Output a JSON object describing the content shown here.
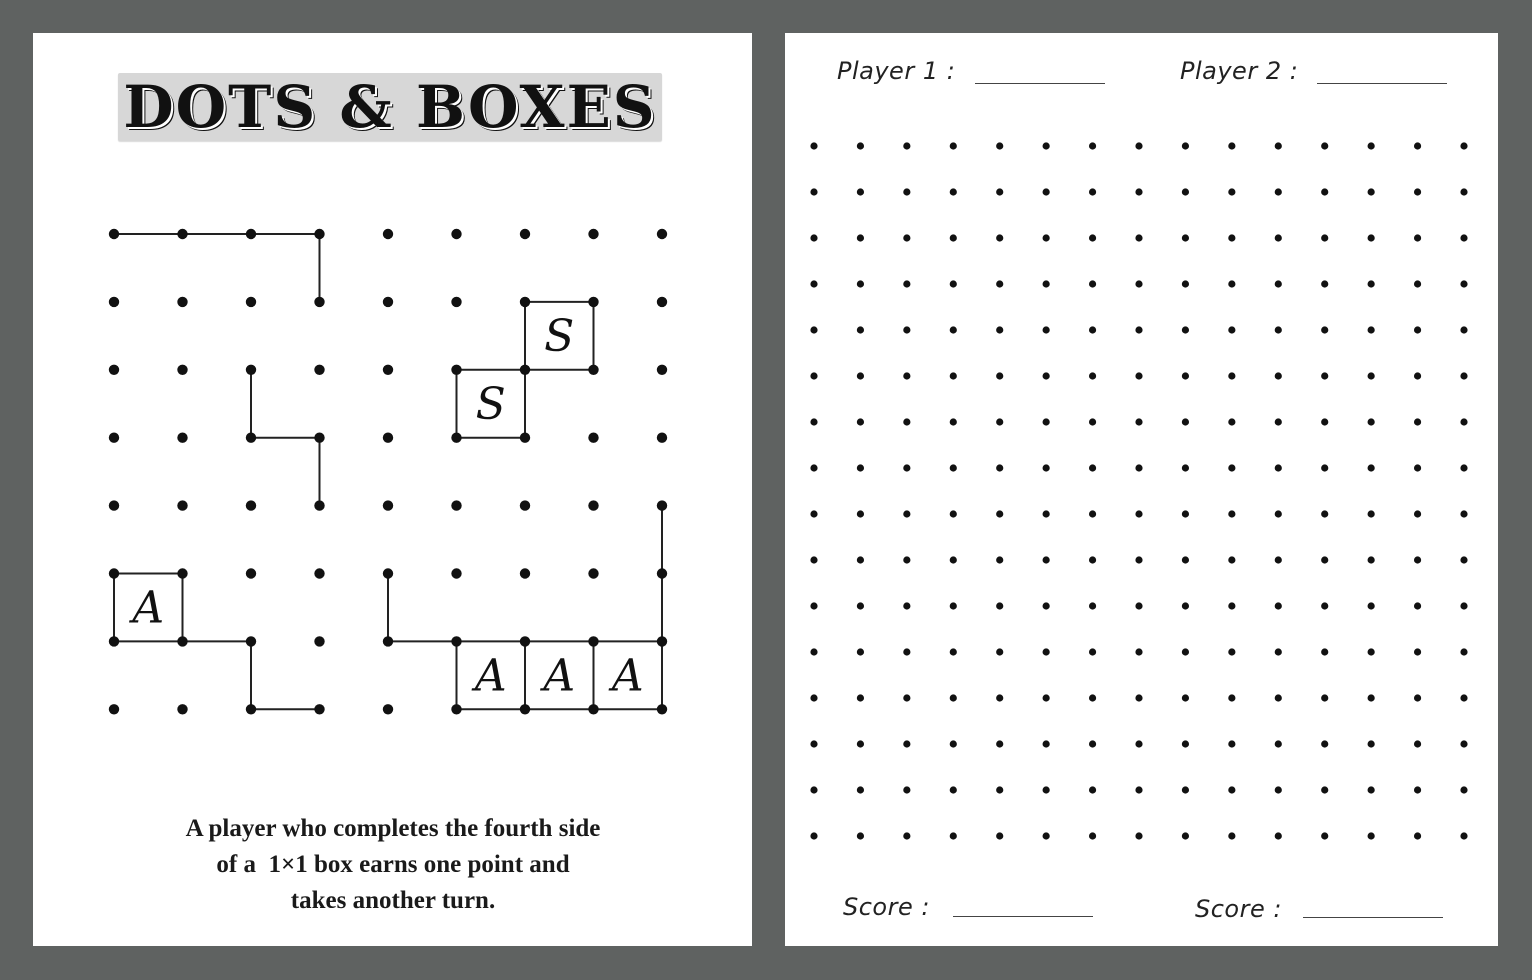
{
  "colors": {
    "background": "#5f6261",
    "paper": "#ffffff",
    "title_banner": "#d7d7d7",
    "ink": "#111111"
  },
  "left_page": {
    "title": "DOTS & BOXES",
    "example_board": {
      "columns": 9,
      "rows": 8,
      "lines": [
        {
          "from": [
            0,
            0
          ],
          "to": [
            1,
            0
          ]
        },
        {
          "from": [
            1,
            0
          ],
          "to": [
            2,
            0
          ]
        },
        {
          "from": [
            2,
            0
          ],
          "to": [
            3,
            0
          ]
        },
        {
          "from": [
            3,
            0
          ],
          "to": [
            3,
            1
          ]
        },
        {
          "from": [
            2,
            2
          ],
          "to": [
            2,
            3
          ]
        },
        {
          "from": [
            2,
            3
          ],
          "to": [
            3,
            3
          ]
        },
        {
          "from": [
            3,
            3
          ],
          "to": [
            3,
            4
          ]
        },
        {
          "from": [
            6,
            1
          ],
          "to": [
            7,
            1
          ]
        },
        {
          "from": [
            6,
            1
          ],
          "to": [
            6,
            2
          ]
        },
        {
          "from": [
            7,
            1
          ],
          "to": [
            7,
            2
          ]
        },
        {
          "from": [
            5,
            2
          ],
          "to": [
            6,
            2
          ]
        },
        {
          "from": [
            6,
            2
          ],
          "to": [
            7,
            2
          ]
        },
        {
          "from": [
            5,
            2
          ],
          "to": [
            5,
            3
          ]
        },
        {
          "from": [
            6,
            2
          ],
          "to": [
            6,
            3
          ]
        },
        {
          "from": [
            5,
            3
          ],
          "to": [
            6,
            3
          ]
        },
        {
          "from": [
            0,
            5
          ],
          "to": [
            1,
            5
          ]
        },
        {
          "from": [
            0,
            5
          ],
          "to": [
            0,
            6
          ]
        },
        {
          "from": [
            1,
            5
          ],
          "to": [
            1,
            6
          ]
        },
        {
          "from": [
            0,
            6
          ],
          "to": [
            1,
            6
          ]
        },
        {
          "from": [
            1,
            6
          ],
          "to": [
            2,
            6
          ]
        },
        {
          "from": [
            2,
            6
          ],
          "to": [
            2,
            7
          ]
        },
        {
          "from": [
            2,
            7
          ],
          "to": [
            3,
            7
          ]
        },
        {
          "from": [
            4,
            5
          ],
          "to": [
            4,
            6
          ]
        },
        {
          "from": [
            4,
            6
          ],
          "to": [
            5,
            6
          ]
        },
        {
          "from": [
            5,
            6
          ],
          "to": [
            6,
            6
          ]
        },
        {
          "from": [
            6,
            6
          ],
          "to": [
            7,
            6
          ]
        },
        {
          "from": [
            7,
            6
          ],
          "to": [
            8,
            6
          ]
        },
        {
          "from": [
            8,
            4
          ],
          "to": [
            8,
            5
          ]
        },
        {
          "from": [
            8,
            5
          ],
          "to": [
            8,
            6
          ]
        },
        {
          "from": [
            5,
            6
          ],
          "to": [
            5,
            7
          ]
        },
        {
          "from": [
            6,
            6
          ],
          "to": [
            6,
            7
          ]
        },
        {
          "from": [
            7,
            6
          ],
          "to": [
            7,
            7
          ]
        },
        {
          "from": [
            8,
            6
          ],
          "to": [
            8,
            7
          ]
        },
        {
          "from": [
            5,
            7
          ],
          "to": [
            6,
            7
          ]
        },
        {
          "from": [
            6,
            7
          ],
          "to": [
            7,
            7
          ]
        },
        {
          "from": [
            7,
            7
          ],
          "to": [
            8,
            7
          ]
        }
      ],
      "claimed_boxes": [
        {
          "col": 6,
          "row": 1,
          "owner": "S"
        },
        {
          "col": 5,
          "row": 2,
          "owner": "S"
        },
        {
          "col": 0,
          "row": 5,
          "owner": "A"
        },
        {
          "col": 5,
          "row": 6,
          "owner": "A"
        },
        {
          "col": 6,
          "row": 6,
          "owner": "A"
        },
        {
          "col": 7,
          "row": 6,
          "owner": "A"
        }
      ]
    },
    "rule_lines": [
      "A player who completes the fourth side",
      "of a  1×1 box earns one point and",
      "takes another turn."
    ]
  },
  "right_page": {
    "player1_label": "Player 1 :",
    "player2_label": "Player 2 :",
    "player1_name": "",
    "player2_name": "",
    "score1_label": "Score :",
    "score2_label": "Score :",
    "score1_value": "",
    "score2_value": "",
    "blank_grid": {
      "columns": 15,
      "rows": 16
    }
  }
}
